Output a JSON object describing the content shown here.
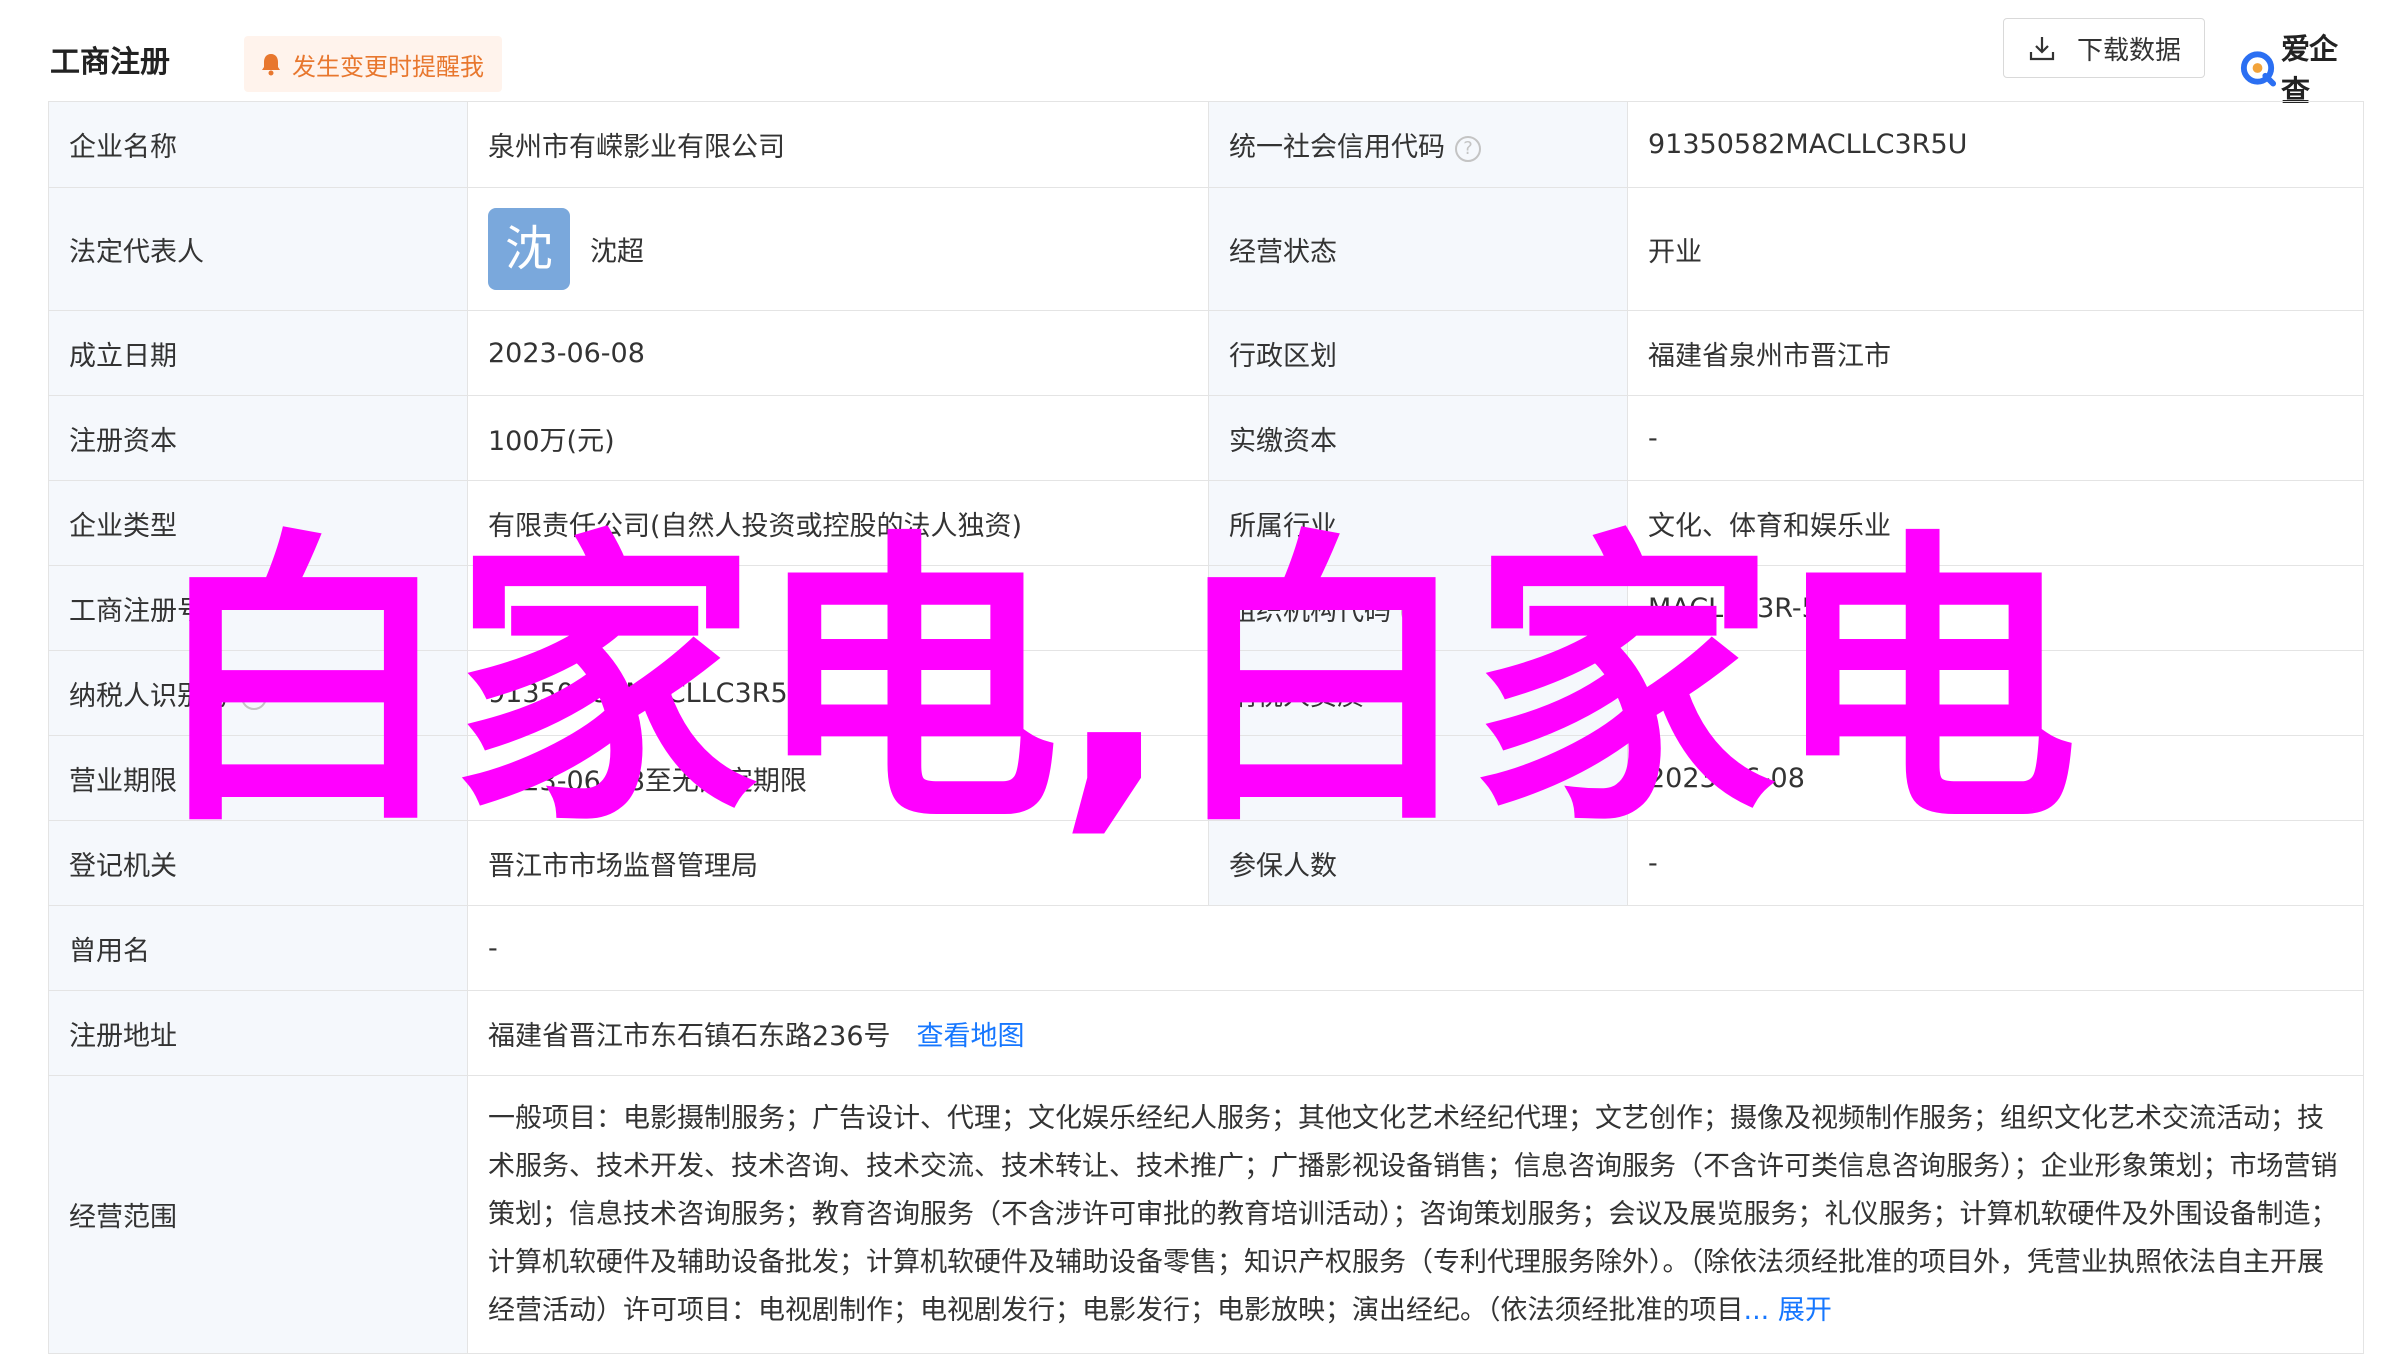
{
  "header": {
    "title": "工商注册",
    "alert_label": "发生变更时提醒我",
    "download_label": "下载数据",
    "brand": "爱企查"
  },
  "rows": {
    "company_name": {
      "label": "企业名称",
      "value": "泉州市有嵘影业有限公司"
    },
    "credit_code": {
      "label": "统一社会信用代码",
      "value": "91350582MACLLC3R5U"
    },
    "legal_rep": {
      "label": "法定代表人",
      "avatar_char": "沈",
      "value": "沈超"
    },
    "status": {
      "label": "经营状态",
      "value": "开业"
    },
    "founded": {
      "label": "成立日期",
      "value": "2023-06-08"
    },
    "district": {
      "label": "行政区划",
      "value": "福建省泉州市晋江市"
    },
    "reg_capital": {
      "label": "注册资本",
      "value": "100万(元)"
    },
    "paid_capital": {
      "label": "实缴资本",
      "value": "-"
    },
    "company_type": {
      "label": "企业类型",
      "value": "有限责任公司(自然人投资或控股的法人独资)"
    },
    "industry": {
      "label": "所属行业",
      "value": "文化、体育和娱乐业"
    },
    "reg_no": {
      "label": "工商注册号",
      "value": ""
    },
    "org_code": {
      "label": "组织机构代码",
      "value": "MACLLC3R-5"
    },
    "taxpayer_id": {
      "label": "纳税人识别号",
      "value": "91350582MACLLC3R5U"
    },
    "taxpayer_qual": {
      "label": "纳税人资质",
      "value": "-"
    },
    "term": {
      "label": "营业期限",
      "value": "2023-06-08至无固定期限"
    },
    "approval_date": {
      "label": "核准日期",
      "value": "2023-06-08"
    },
    "authority": {
      "label": "登记机关",
      "value": "晋江市市场监督管理局"
    },
    "insured": {
      "label": "参保人数",
      "value": "-"
    },
    "former_name": {
      "label": "曾用名",
      "value": "-"
    },
    "address": {
      "label": "注册地址",
      "value": "福建省晋江市东石镇石东路236号",
      "map_link": "查看地图"
    },
    "scope": {
      "label": "经营范围",
      "value": "一般项目：电影摄制服务；广告设计、代理；文化娱乐经纪人服务；其他文化艺术经纪代理；文艺创作；摄像及视频制作服务；组织文化艺术交流活动；技术服务、技术开发、技术咨询、技术交流、技术转让、技术推广；广播影视设备销售；信息咨询服务（不含许可类信息咨询服务）；企业形象策划；市场营销策划；信息技术咨询服务；教育咨询服务（不含涉许可审批的教育培训活动）；咨询策划服务；会议及展览服务；礼仪服务；计算机软硬件及外围设备制造；计算机软硬件及辅助设备批发；计算机软硬件及辅助设备零售；知识产权服务（专利代理服务除外）。（除依法须经批准的项目外，凭营业执照依法自主开展经营活动）许可项目：电视剧制作；电视剧发行；电影发行；电影放映；演出经纪。（依法须经批准的项目",
      "expand_label": "... 展开"
    }
  },
  "watermark": "白家电,白家电",
  "colors": {
    "label_bg": "#f5f8fc",
    "link": "#1677ff",
    "alert": "#e8772e",
    "watermark": "#ff00ff",
    "avatar_bg": "#7aa8dc"
  }
}
